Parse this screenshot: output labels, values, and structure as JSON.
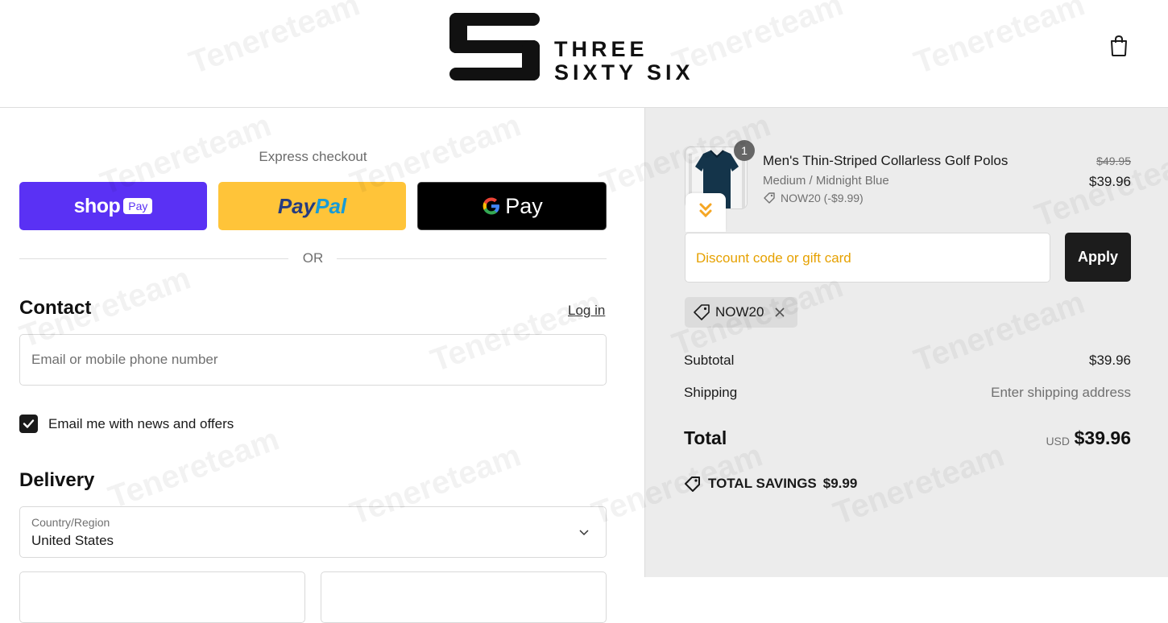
{
  "header": {
    "brand_line1": "THREE",
    "brand_line2": "SIXTY SIX"
  },
  "express": {
    "title": "Express checkout",
    "shop_label": "shop",
    "shop_pay_label": "Pay",
    "paypal_label_1": "Pay",
    "paypal_label_2": "Pal",
    "gpay_label": "Pay"
  },
  "divider": {
    "or_label": "OR"
  },
  "contact": {
    "title": "Contact",
    "login_label": "Log in",
    "email_placeholder": "Email or mobile phone number",
    "newsletter_label": "Email me with news and offers",
    "newsletter_checked": true
  },
  "delivery": {
    "title": "Delivery",
    "country_label": "Country/Region",
    "country_value": "United States"
  },
  "order": {
    "item": {
      "quantity": "1",
      "name": "Men's Thin-Striped Collarless Golf Polos",
      "variant": "Medium / Midnight Blue",
      "discount": "NOW20 (-$9.99)",
      "original_price": "$49.95",
      "price": "$39.96"
    },
    "discount_placeholder": "Discount code or gift card",
    "apply_label": "Apply",
    "applied_code": "NOW20",
    "subtotal_label": "Subtotal",
    "subtotal_value": "$39.96",
    "shipping_label": "Shipping",
    "shipping_value": "Enter shipping address",
    "total_label": "Total",
    "total_currency": "USD",
    "total_value": "$39.96",
    "savings_label": "TOTAL SAVINGS",
    "savings_value": "$9.99"
  },
  "watermark": "Tenereteam",
  "colors": {
    "shop_pay": "#5a31f4",
    "paypal": "#ffc439",
    "gpay": "#000000",
    "apply": "#1c1c1c",
    "discount_placeholder": "#e6a100"
  }
}
